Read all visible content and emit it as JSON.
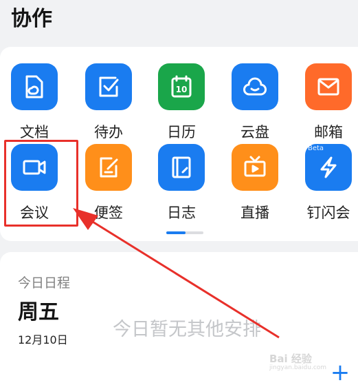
{
  "header": {
    "title": "协作"
  },
  "apps": [
    {
      "label": "文档",
      "icon": "document-icon",
      "color": "#1a7cf0"
    },
    {
      "label": "待办",
      "icon": "checkbox-icon",
      "color": "#1a7cf0"
    },
    {
      "label": "日历",
      "icon": "calendar-icon",
      "color": "#1aa64a",
      "icon_text": "10"
    },
    {
      "label": "云盘",
      "icon": "cloud-drive-icon",
      "color": "#1a7cf0"
    },
    {
      "label": "邮箱",
      "icon": "mail-icon",
      "color": "#ff6a2a"
    },
    {
      "label": "会议",
      "icon": "video-camera-icon",
      "color": "#1a7cf0"
    },
    {
      "label": "便签",
      "icon": "note-edit-icon",
      "color": "#ff8f1a"
    },
    {
      "label": "日志",
      "icon": "journal-icon",
      "color": "#1a7cf0"
    },
    {
      "label": "直播",
      "icon": "live-tv-icon",
      "color": "#ff8f1a"
    },
    {
      "label": "钉闪会",
      "icon": "lightning-icon",
      "color": "#1a7cf0",
      "badge": "Beta"
    }
  ],
  "pager": {
    "pages": 2,
    "active": 1
  },
  "schedule": {
    "title": "今日日程",
    "weekday": "周五",
    "date": "12月10日",
    "empty_text": "今日暂无其他安排",
    "add_label": "+"
  },
  "watermark": {
    "text": "Bai 经验",
    "sub": "jingyan.baidu.com"
  },
  "colors": {
    "accent": "#1a7cf0",
    "annotation": "#e8302a"
  }
}
